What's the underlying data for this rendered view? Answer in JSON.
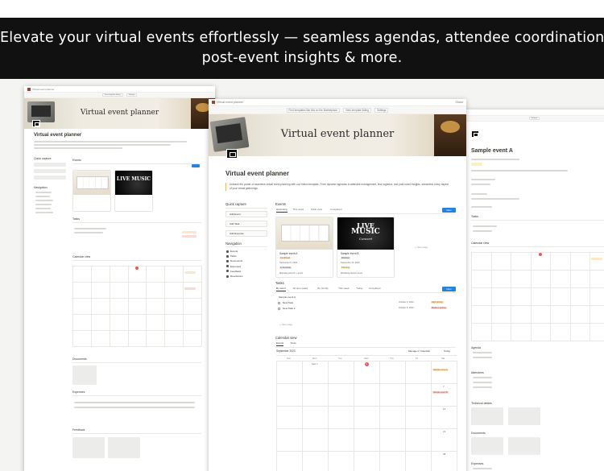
{
  "banner": {
    "line1": "Elevate your virtual events effortlessly — seamless agendas, attendee coordination,",
    "line2": "post-event insights & more."
  },
  "colors": {
    "banner_bg": "#111111",
    "accent_blue": "#2383e2",
    "today_red": "#eb5757",
    "tag_orange": "#fbe8c8",
    "tag_red": "#f8d9d4"
  },
  "main": {
    "breadcrumb": "Virtual event planner",
    "share": "Share",
    "notice": {
      "text": "Find templates like this on the Marketplace",
      "view": "View template listing",
      "settings": "Settings"
    },
    "cover_title": "Virtual event planner",
    "page_title": "Virtual event planner",
    "intro": "Unleash the power of seamless virtual event planning with our Notion template. From dynamic agendas to attendee management, tech logistics, and post-event insights, streamline every aspect of your virtual gatherings.",
    "quick_capture": {
      "heading": "Quick capture",
      "items": [
        "Add Event",
        "Add Task",
        "Add Expense"
      ]
    },
    "navigation": {
      "heading": "Navigation",
      "items": [
        "Events",
        "Tasks",
        "Documents",
        "Expenses",
        "Feedback",
        "Resolutions"
      ]
    },
    "events": {
      "heading": "Events",
      "views": [
        "Upcoming",
        "This week",
        "Table view",
        "Completed"
      ],
      "new": "New",
      "cards": [
        {
          "title": "Sample event A",
          "status": "Confirmed",
          "date": "September 9, 2023",
          "tag": "In Accurate",
          "foot": "Marketing launch + event"
        },
        {
          "title": "Sample event B",
          "status": "Webinar",
          "date": "September 10, 2023",
          "tag": "Planning",
          "foot": "Workshop launch event"
        }
      ],
      "new_page": "+ New page",
      "cover_b_line1": "LIVE",
      "cover_b_line2": "MUSIC",
      "cover_b_line3": "Concert"
    },
    "tasks": {
      "heading": "Tasks",
      "views": [
        "By event",
        "All open tasks",
        "By priority",
        "This week",
        "Today",
        "Completed"
      ],
      "group": "Sample event A",
      "rows": [
        {
          "name": "New Task",
          "date": "October 3, 2024",
          "status": "High priority"
        },
        {
          "name": "New Task 2",
          "date": "October 8, 2024",
          "status": "Medium priority"
        }
      ],
      "new_page": "+ New page"
    },
    "calendar": {
      "heading": "Calendar view",
      "views": [
        "Events",
        "Tasks"
      ],
      "month": "September 2023",
      "manage": "Manage in Calendar",
      "today": "Today",
      "days": [
        "Sun",
        "Mon",
        "Tue",
        "Wed",
        "Thu",
        "Fri",
        "Sat"
      ],
      "first_day": "Sep 1",
      "today_num": "3",
      "event_a": "Sample event A",
      "event_b": "Sample event B",
      "week_nums": [
        "7",
        "14",
        "21",
        "28"
      ]
    }
  },
  "left": {
    "cover_title": "Virtual event planner",
    "page_title": "Virtual event planner",
    "sections": [
      "Quick capture",
      "Navigation",
      "Events",
      "Tasks",
      "Calendar view",
      "Documents",
      "Expenses",
      "Feedback"
    ],
    "live": "LIVE MUSIC"
  },
  "right": {
    "page_title": "Sample event A",
    "sections": [
      "Tasks",
      "Calendar view",
      "Agenda",
      "Attendees",
      "Technical details",
      "Documents",
      "Expenses"
    ]
  }
}
